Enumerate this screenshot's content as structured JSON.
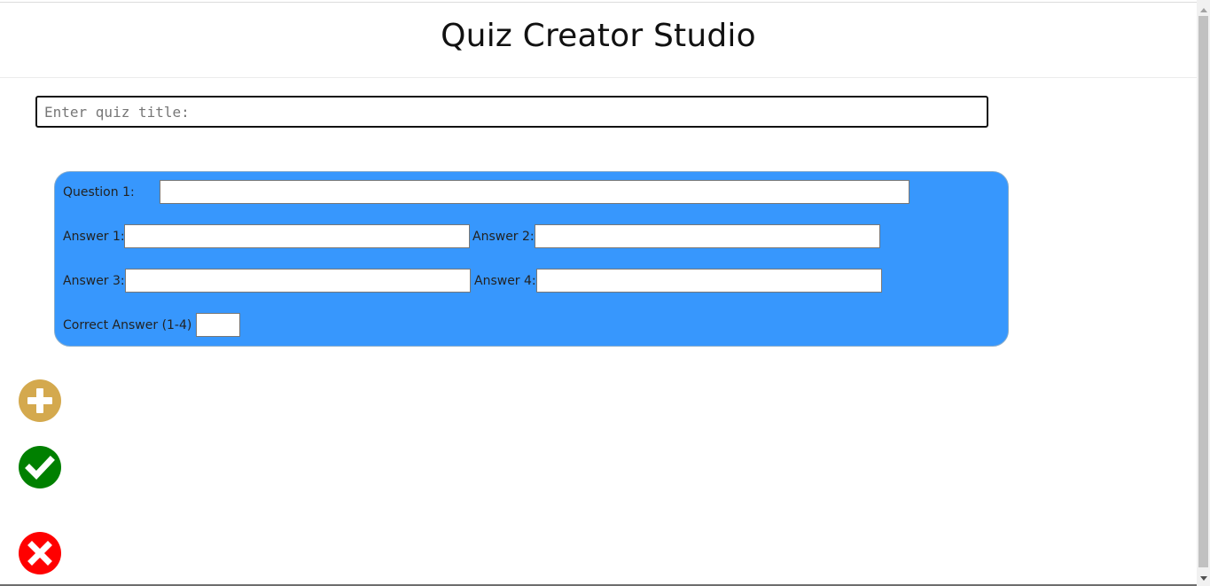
{
  "header": {
    "title": "Quiz Creator Studio"
  },
  "quiz_title": {
    "placeholder": "Enter quiz title:",
    "value": ""
  },
  "question_card": {
    "question_label": "Question 1:",
    "answer1_label": "Answer 1:",
    "answer2_label": "Answer 2:",
    "answer3_label": "Answer 3:",
    "answer4_label": "Answer 4:",
    "correct_label": "Correct Answer (1-4) :"
  },
  "actions": {
    "add_icon": "plus-circle-icon",
    "save_icon": "check-circle-icon",
    "cancel_icon": "x-circle-icon"
  },
  "colors": {
    "card": "#3797fd",
    "add": "#d4a94e",
    "save": "#008000",
    "cancel": "#ff0000"
  }
}
